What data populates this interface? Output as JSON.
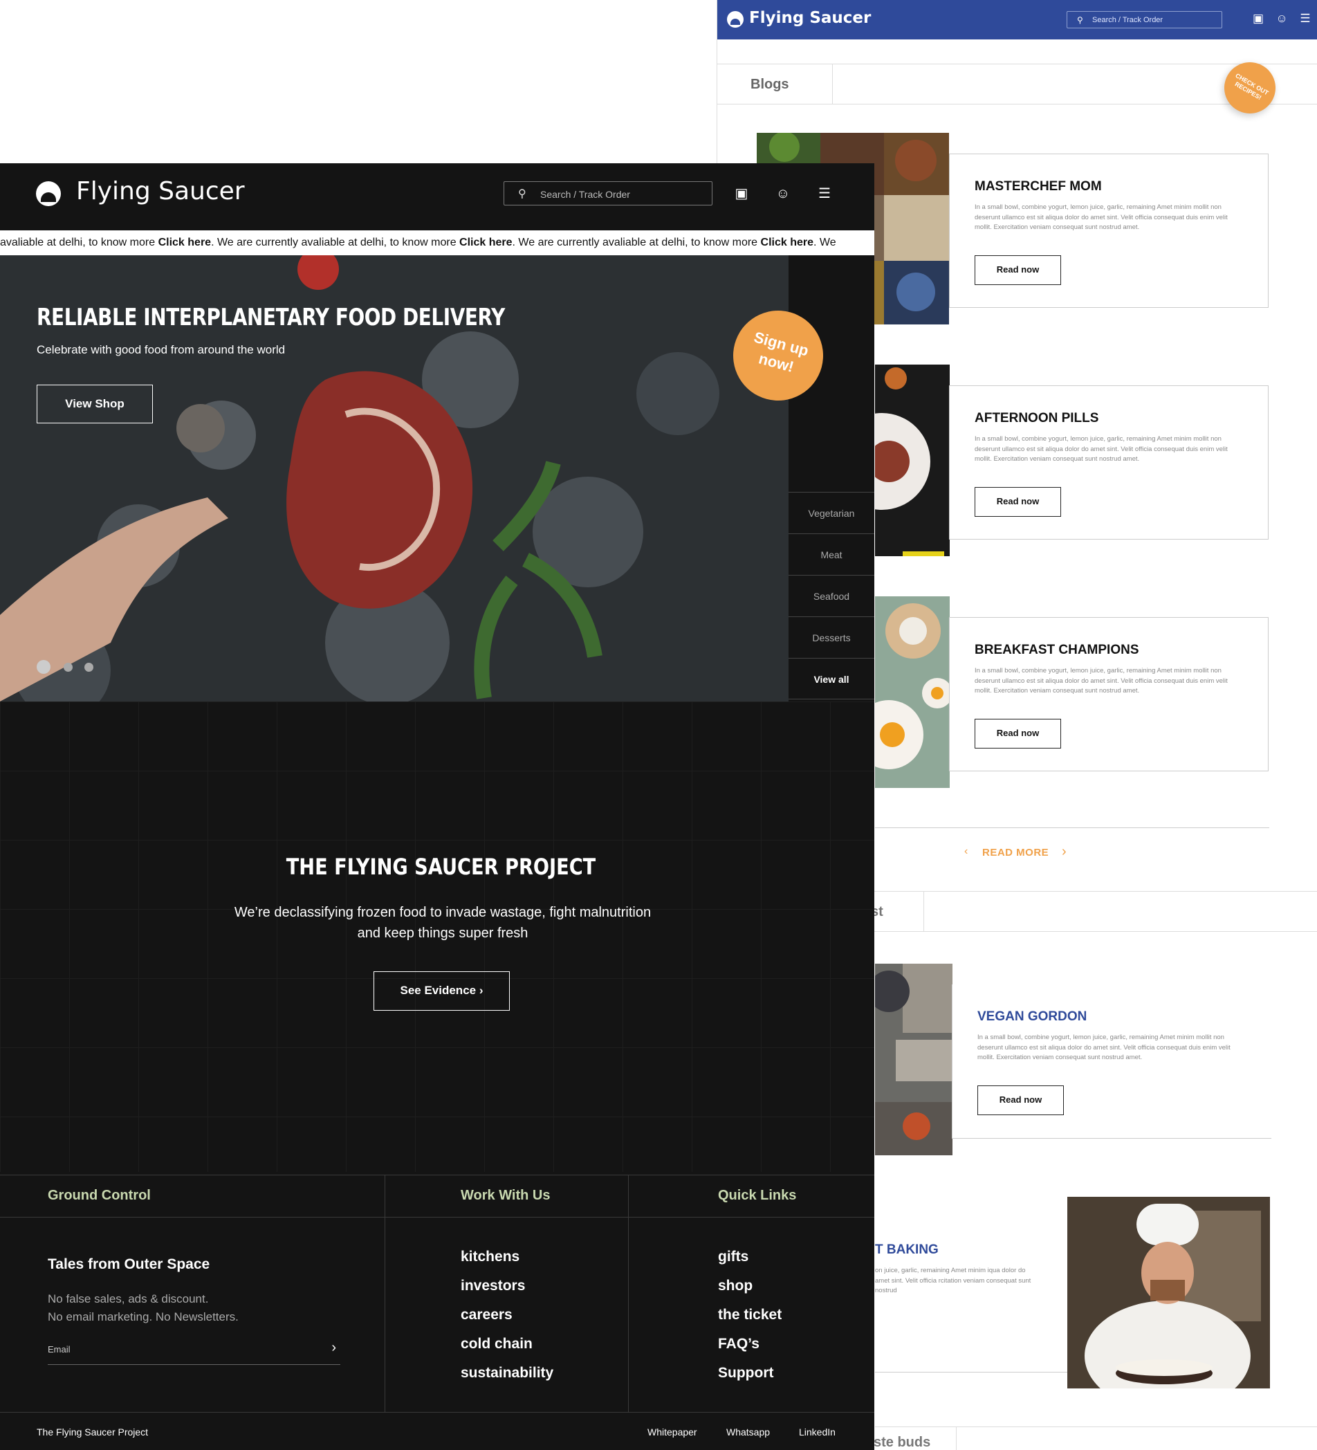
{
  "back": {
    "brand": "Flying Saucer",
    "search_placeholder": "Search / Track Order",
    "blogs_tab": "Blogs",
    "sticker": "CHECK OUT RECIPES!",
    "cards": [
      {
        "title": "MASTERCHEF MOM",
        "button": "Read now"
      },
      {
        "title": "AFTERNOON PILLS",
        "button": "Read now"
      },
      {
        "title": "BREAKFAST CHAMPIONS",
        "button": "Read now"
      }
    ],
    "card_desc": "In a small bowl, combine yogurt, lemon juice, garlic, remaining Amet minim mollit non deserunt ullamco est sit aliqua dolor do amet sint. Velit officia consequat duis enim velit mollit. Exercitation veniam consequat sunt nostrud amet.",
    "read_more": "READ MORE",
    "section2_tab": "st",
    "vegan": {
      "title": "VEGAN GORDON",
      "button": "Read now"
    },
    "baking_title": "T BAKING",
    "baking_desc": "on juice, garlic, remaining Amet minim iqua dolor do amet sint. Velit officia rcitation veniam consequat sunt nostrud",
    "bottom_tab": "ste buds"
  },
  "front": {
    "brand": "Flying Saucer",
    "search_placeholder": "Search / Track Order",
    "ticker": [
      {
        "t": "avaliable at delhi, to know more ",
        "b": "Click here"
      },
      {
        "t": ".  We are currently avaliable at delhi, to know more ",
        "b": "Click here"
      },
      {
        "t": ".  We are currently avaliable at delhi, to know more ",
        "b": "Click here"
      },
      {
        "t": ".  We",
        "b": ""
      }
    ],
    "hero": {
      "title": "RELIABLE INTERPLANETARY FOOD DELIVERY",
      "subtitle": "Celebrate with good food from around the world",
      "button": "View Shop",
      "signup_1": "Sign up",
      "signup_2": "now!"
    },
    "categories": [
      "Vegetarian",
      "Meat",
      "Seafood",
      "Desserts",
      "View all"
    ],
    "project": {
      "title": "THE FLYING SAUCER PROJECT",
      "desc_1": "We’re declassifying frozen food to invade wastage, fight malnutrition",
      "desc_2": "and keep things super fresh",
      "button": "See Evidence"
    },
    "footer": {
      "col1_head": "Ground Control",
      "col2_head": "Work With Us",
      "col3_head": "Quick Links",
      "tales": "Tales from Outer Space",
      "nofalse_1": "No false sales, ads & discount.",
      "nofalse_2": "No email marketing. No Newsletters.",
      "email_placeholder": "Email",
      "work_links": [
        "kitchens",
        "investors",
        "careers",
        "cold chain",
        "sustainability"
      ],
      "quick_links": [
        "gifts",
        "shop",
        "the ticket",
        "FAQ’s",
        "Support"
      ],
      "copyright": "The Flying Saucer Project",
      "bottom_links": [
        "Whitepaper",
        "Whatsapp",
        "LinkedIn"
      ]
    }
  },
  "colors": {
    "accent_orange": "#f0a14a",
    "brand_blue": "#2f4a9a",
    "footer_green": "#c9d9b0",
    "dark_bg": "#141414"
  }
}
